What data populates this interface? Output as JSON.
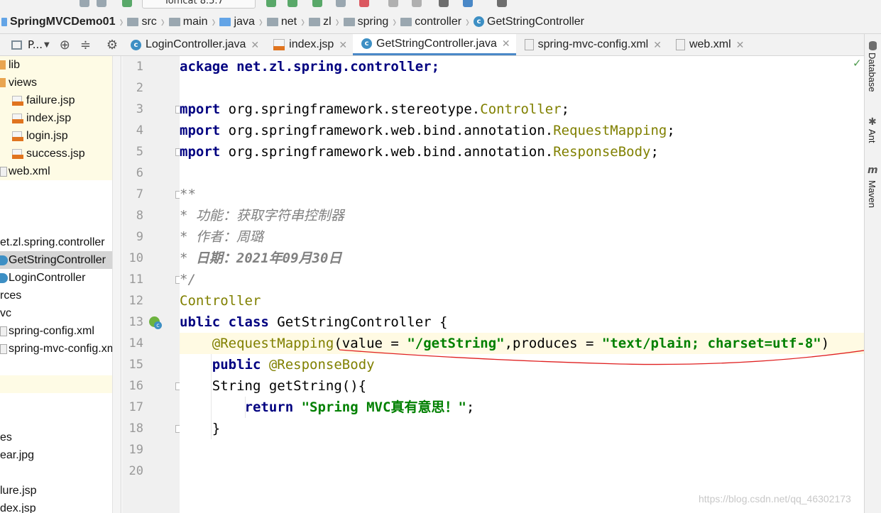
{
  "run_config_label": "Tomcat 8.5.7",
  "breadcrumb": [
    "SpringMVCDemo01",
    "src",
    "main",
    "java",
    "net",
    "zl",
    "spring",
    "controller",
    "GetStringController"
  ],
  "project_panel": {
    "title": "P..."
  },
  "project_tree": [
    "lib",
    "views",
    "failure.jsp",
    "index.jsp",
    "login.jsp",
    "success.jsp",
    "web.xml",
    "et.zl.spring.controller",
    "GetStringController",
    "LoginController",
    "rces",
    "vc",
    "spring-config.xml",
    "spring-mvc-config.xml",
    "es",
    "ear.jpg",
    "lure.jsp",
    "dex.jsp"
  ],
  "tabs": [
    {
      "label": "LoginController.java",
      "icon": "class-icon"
    },
    {
      "label": "index.jsp",
      "icon": "jsp-icon"
    },
    {
      "label": "GetStringController.java",
      "icon": "class-icon",
      "active": true
    },
    {
      "label": "spring-mvc-config.xml",
      "icon": "xml-icon"
    },
    {
      "label": "web.xml",
      "icon": "xml-icon"
    }
  ],
  "line_numbers": [
    "1",
    "2",
    "3",
    "4",
    "5",
    "6",
    "7",
    "8",
    "9",
    "10",
    "11",
    "12",
    "13",
    "14",
    "15",
    "16",
    "17",
    "18",
    "19",
    "20"
  ],
  "code": {
    "l1": "ackage net.zl.spring.controller;",
    "l3a": "mport",
    "l3b": " org.springframework.stereotype.",
    "l3c": "Controller",
    "l3d": ";",
    "l4a": "mport",
    "l4b": " org.springframework.web.bind.annotation.",
    "l4c": "RequestMapping",
    "l4d": ";",
    "l5a": "mport",
    "l5b": " org.springframework.web.bind.annotation.",
    "l5c": "ResponseBody",
    "l5d": ";",
    "l7": "**",
    "l8a": "* ",
    "l8b": "功能：获取字符串控制器",
    "l9a": "* ",
    "l9b": "作者：周璐",
    "l10a": "* ",
    "l10b": "日期：2021年09月30日",
    "l11": "*/",
    "l12": "Controller",
    "l13a": "ublic class",
    "l13b": " GetStringController {",
    "l14a": "@RequestMapping",
    "l14b": "(value = ",
    "l14c": "\"/getString\"",
    "l14d": ",produces = ",
    "l14e": "\"text/plain; charset=utf-8\"",
    "l14f": ")",
    "l15a": "public",
    "l15b": "@ResponseBody",
    "l16": "String getString(){",
    "l17a": "return",
    "l17b": "\"Spring MVC真有意思！\"",
    "l17c": ";",
    "l18": "}"
  },
  "right_tools": [
    "Database",
    "Ant",
    "Maven"
  ],
  "watermark": "https://blog.csdn.net/qq_46302173"
}
